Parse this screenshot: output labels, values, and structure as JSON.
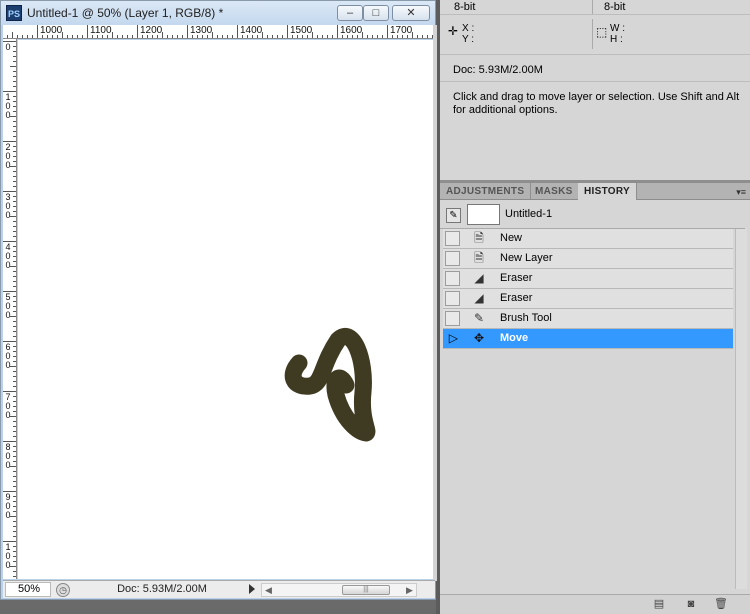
{
  "document_window": {
    "app_icon": "PS",
    "title": "Untitled-1 @ 50% (Layer 1, RGB/8) *",
    "buttons": {
      "minimize": "–",
      "maximize": "□",
      "close": "✕"
    },
    "ruler_top_labels": [
      "1000",
      "1100",
      "1200",
      "1300",
      "1400",
      "1500",
      "1600",
      "1700"
    ],
    "ruler_left_labels": [
      "0",
      "100",
      "200",
      "300",
      "400",
      "500",
      "600",
      "700",
      "800",
      "900",
      "100"
    ],
    "brush_stroke_color": "#3f3a22",
    "status": {
      "zoom": "50%",
      "doc_size": "Doc: 5.93M/2.00M"
    }
  },
  "info_panel": {
    "bit_depth_left": "8-bit",
    "bit_depth_right": "8-bit",
    "x_label": "X :",
    "y_label": "Y :",
    "w_label": "W :",
    "h_label": "H :",
    "doc_size": "Doc: 5.93M/2.00M",
    "hint": "Click and drag to move layer or selection.  Use Shift and Alt for additional options."
  },
  "tabs": [
    {
      "label": "ADJUSTMENTS",
      "active": false
    },
    {
      "label": "MASKS",
      "active": false
    },
    {
      "label": "HISTORY",
      "active": true
    }
  ],
  "history": {
    "snapshot_name": "Untitled-1",
    "items": [
      {
        "label": "New",
        "icon": "document-icon",
        "active": false
      },
      {
        "label": "New Layer",
        "icon": "document-icon",
        "active": false
      },
      {
        "label": "Eraser",
        "icon": "eraser-icon",
        "active": false
      },
      {
        "label": "Eraser",
        "icon": "eraser-icon",
        "active": false
      },
      {
        "label": "Brush Tool",
        "icon": "brush-icon",
        "active": false
      },
      {
        "label": "Move",
        "icon": "move-icon",
        "active": true
      }
    ]
  },
  "colors": {
    "selection": "#3399ff",
    "panel_bg": "#d6d6d6"
  }
}
